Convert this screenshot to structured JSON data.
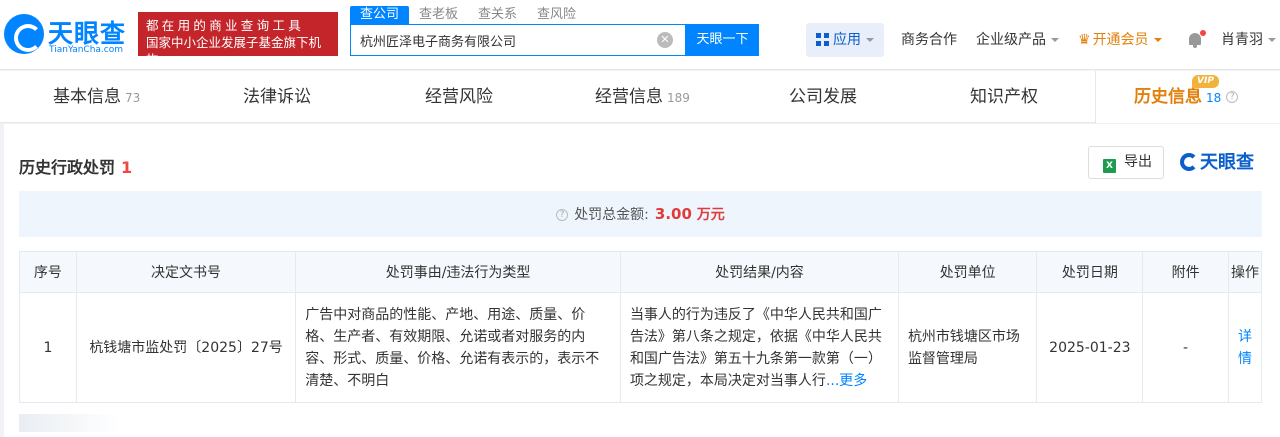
{
  "header": {
    "logo_text": "天眼查",
    "logo_sub": "TianYanCha.com",
    "slogan_line1": "都在用的商业查询工具",
    "slogan_line2": "国家中小企业发展子基金旗下机构",
    "search_tabs": [
      "查公司",
      "查老板",
      "查关系",
      "查风险"
    ],
    "search_value": "杭州匠泽电子商务有限公司",
    "search_button": "天眼一下",
    "apps_label": "应用",
    "nav": [
      "商务合作",
      "企业级产品"
    ],
    "vip_label": "开通会员",
    "user_name": "肖青羽"
  },
  "tabs": [
    {
      "label": "基本信息",
      "count": "73"
    },
    {
      "label": "法律诉讼",
      "count": ""
    },
    {
      "label": "经营风险",
      "count": ""
    },
    {
      "label": "经营信息",
      "count": "189"
    },
    {
      "label": "公司发展",
      "count": ""
    },
    {
      "label": "知识产权",
      "count": ""
    },
    {
      "label": "历史信息",
      "count": "18",
      "badge": "VIP"
    }
  ],
  "section": {
    "title": "历史行政处罚",
    "count": "1",
    "export_label": "导出",
    "brand": "天眼查"
  },
  "summary": {
    "label": "处罚总金额:",
    "value": "3.00",
    "unit": "万元"
  },
  "table": {
    "headers": [
      "序号",
      "决定文书号",
      "处罚事由/违法行为类型",
      "处罚结果/内容",
      "处罚单位",
      "处罚日期",
      "附件",
      "操作"
    ],
    "rows": [
      {
        "index": "1",
        "doc_no": "杭钱塘市监处罚〔2025〕27号",
        "reason": "广告中对商品的性能、产地、用途、质量、价格、生产者、有效期限、允诺或者对服务的内容、形式、质量、价格、允诺有表示的，表示不清楚、不明白",
        "result": "当事人的行为违反了《中华人民共和国广告法》第八条之规定，依据《中华人民共和国广告法》第五十九条第一款第（一）项之规定，本局决定对当事人行",
        "more": "...更多",
        "org": "杭州市钱塘区市场监督管理局",
        "date": "2025-01-23",
        "attachment": "-",
        "action": "详情"
      }
    ]
  },
  "colors": {
    "brand_blue": "#0084ff",
    "slogan_red": "#c3252a",
    "vip_orange": "#e3800b",
    "alert_red": "#e03b3b"
  }
}
